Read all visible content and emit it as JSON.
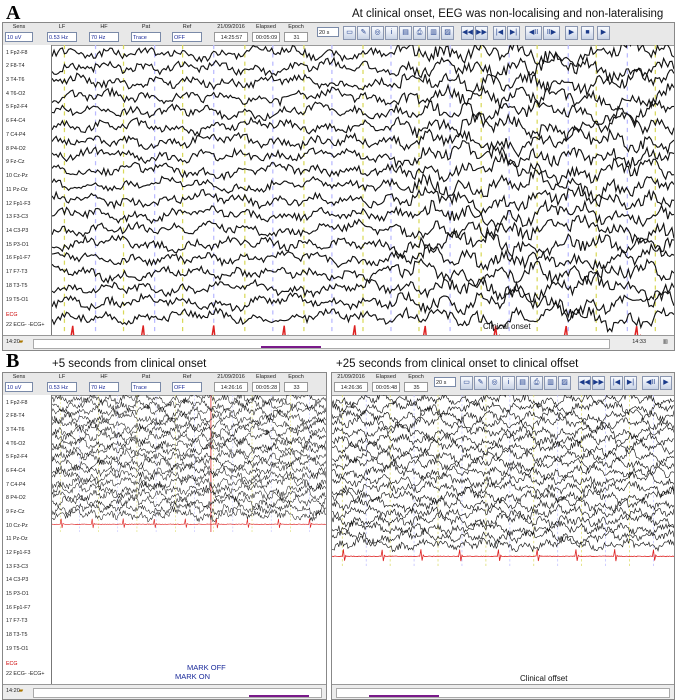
{
  "figure": {
    "panel_a_letter": "A",
    "panel_b_letter": "B",
    "caption_a": "At clinical onset, EEG was non-localising and non-lateralising",
    "caption_b_left": "+5 seconds from clinical onset",
    "caption_b_right": "+25 seconds from clinical onset to clinical offset"
  },
  "toolbar_labels": {
    "sens": "Sens",
    "lf": "LF",
    "hf": "HF",
    "pat": "Pat",
    "ref": "Ref",
    "elapsed": "Elapsed",
    "epoch": "Epoch"
  },
  "toolbar_values": {
    "sens": "10 uV",
    "lf": "0.53 Hz",
    "hf": "70 Hz",
    "pat": "Trace",
    "ref": "OFF",
    "window": "20 s"
  },
  "panel_a": {
    "date": "21/09/2016",
    "time": "14:25:57",
    "elapsed": "00:05:09",
    "epoch": "31",
    "start": "14:20",
    "end": "14:33",
    "annotation": "Clinical onset"
  },
  "panel_b_left": {
    "date": "21/09/2016",
    "time": "14:26:16",
    "elapsed": "00:05:28",
    "epoch": "33",
    "start": "14:20",
    "mark_off": "MARK OFF",
    "mark_on": "MARK ON"
  },
  "panel_b_right": {
    "date": "21/09/2016",
    "time": "14:26:36",
    "elapsed": "00:05:48",
    "epoch": "35",
    "window": "20 s",
    "annotation": "Clinical offset"
  },
  "channels": [
    "Fp2-F8",
    "F8-T4",
    "T4-T6",
    "T6-O2",
    "Fp2-F4",
    "F4-C4",
    "C4-P4",
    "P4-O2",
    "Fz-Cz",
    "Cz-Pz",
    "Pz-Oz",
    "Fp1-F3",
    "F3-C3",
    "C3-P3",
    "P3-O1",
    "Fp1-F7",
    "F7-T3",
    "T3-T5",
    "T5-O1"
  ],
  "ecg_label": "ECG",
  "ecg_channel": "ECG- -ECG+",
  "icons": [
    "save-icon",
    "print-icon",
    "annotate-icon",
    "info-icon",
    "montage-icon",
    "export-icon",
    "rewind-icon",
    "fast-forward-icon",
    "go-start-icon",
    "go-end-icon",
    "step-back-icon",
    "step-forward-icon",
    "play-icon",
    "stop-icon",
    "next-icon"
  ]
}
